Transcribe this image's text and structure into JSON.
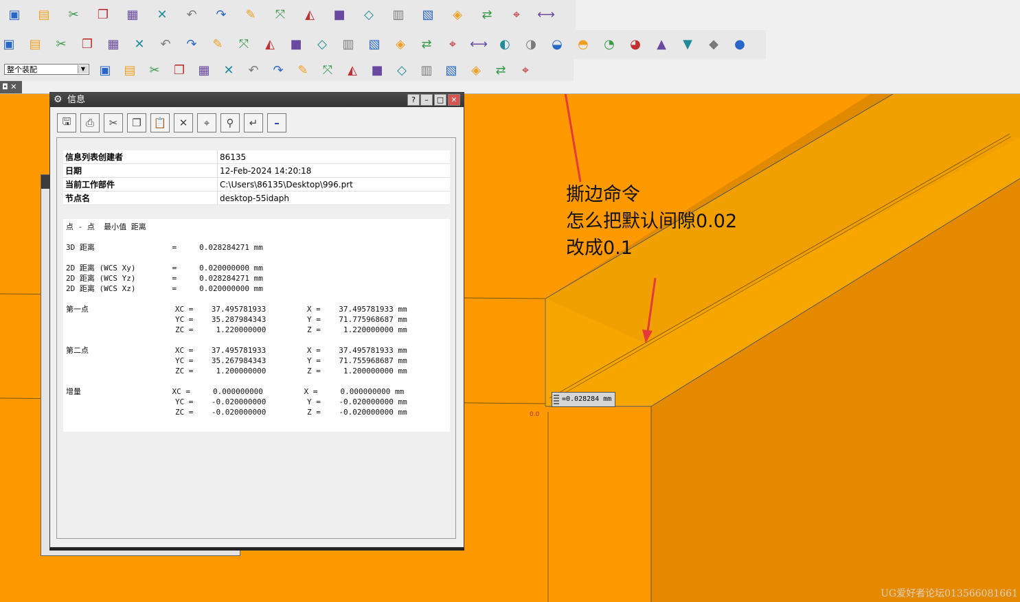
{
  "toolbar": {
    "assembly_filter": "整个装配",
    "row1_icons": [
      "open-folder-icon",
      "save-icon",
      "cut-icon",
      "copy-icon",
      "paste-icon",
      "delete-icon",
      "undo-icon",
      "redo-icon",
      "edit-object-icon",
      "transform-icon",
      "sketch-icon",
      "block-icon",
      "cube-wire-icon",
      "book-icon",
      "part-family-icon",
      "feature-icon",
      "move-icon",
      "snap-icon",
      "measure-icon"
    ],
    "row2_icons": [
      "flange-icon",
      "bend-icon",
      "contour-icon",
      "loft-icon",
      "jog-icon",
      "corner-icon",
      "tab-icon",
      "bracket-icon",
      "louver-icon",
      "drawing-icon",
      "unbend-icon",
      "box-icon",
      "dimple-icon",
      "cone-icon",
      "gusset-icon",
      "stamp-icon",
      "rip-icon",
      "rebend-icon",
      "break-icon",
      "mitre-icon",
      "hem-icon",
      "rip-corner-icon",
      "color-icon",
      "paint-icon",
      "frame-icon",
      "export-icon",
      "flip-icon",
      "tab-strip-icon",
      "layers-icon"
    ],
    "row3_icons": [
      "filter-icon",
      "select-icon",
      "snap-point-icon",
      "move-point-icon",
      "select-box-icon",
      "view-icon",
      "shade-icon",
      "select-all-icon",
      "line-icon",
      "arc-icon",
      "endpoint-icon",
      "center-icon",
      "tangent-icon",
      "intersect-icon",
      "slash-icon",
      "surface-icon",
      "face-icon",
      "list-icon"
    ]
  },
  "tab": {
    "label": "◘ ✕"
  },
  "info_dialog": {
    "title": "信息",
    "title_buttons": [
      "?",
      "–",
      "□",
      "✕"
    ],
    "tool_icons": [
      "save-report-icon",
      "print-icon",
      "cut-icon",
      "copy-icon",
      "paste-icon",
      "delete-icon",
      "target-icon",
      "find-icon",
      "wrap-icon",
      "minimize-icon"
    ],
    "meta": [
      {
        "key": "信息列表创建者",
        "value": "86135"
      },
      {
        "key": "日期",
        "value": "12-Feb-2024 14:20:18"
      },
      {
        "key": "当前工作部件",
        "value": "C:\\Users\\86135\\Desktop\\996.prt"
      },
      {
        "key": "节点名",
        "value": "desktop-55idaph"
      }
    ],
    "report": "点 - 点  最小值 距离\n\n3D 距离                 =     0.028284271 mm\n\n2D 距离 (WCS Xy)        =     0.020000000 mm\n2D 距离 (WCS Yz)        =     0.028284271 mm\n2D 距离 (WCS Xz)        =     0.020000000 mm\n\n第一点                   XC =    37.495781933         X =    37.495781933 mm\n                        YC =    35.287984343         Y =    71.775968687 mm\n                        ZC =     1.220000000         Z =     1.220000000 mm\n\n第二点                   XC =    37.495781933         X =    37.495781933 mm\n                        YC =    35.267984343         Y =    71.755968687 mm\n                        ZC =     1.200000000         Z =     1.200000000 mm\n\n增量                    XC =     0.000000000         X =     0.000000000 mm\n                        YC =    -0.020000000         Y =    -0.020000000 mm\n                        ZC =    -0.020000000         Z =    -0.020000000 mm"
  },
  "annotation": {
    "line1": "撕边命令",
    "line2": "怎么把默认间隙0.02",
    "line3": "改成0.1"
  },
  "measurement_label": "=0.028284 mm",
  "origin_label": "0.0",
  "watermark": "UG爱好者论坛013566081661",
  "colors": {
    "model_light": "#ff9900",
    "model_dark": "#e58a00",
    "model_mid": "#f5a300",
    "arrow": "#e33a3a"
  }
}
